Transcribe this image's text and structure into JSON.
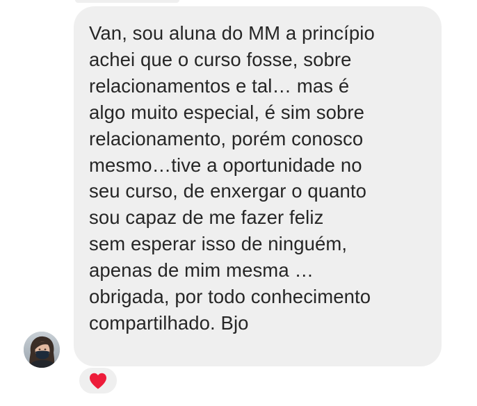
{
  "message": {
    "text": "Van, sou aluna do MM a princípio\nachei que o curso fosse, sobre\nrelacionamentos e tal… mas é\nalgo muito especial, é sim sobre\nrelacionamento, porém conosco\nmesmo…tive a oportunidade no\nseu curso, de enxergar o quanto\nsou capaz de me fazer feliz\nsem esperar isso de ninguém,\napenas de mim mesma …\nobrigada, por todo conhecimento\ncompartilhado. Bjo",
    "bubble_color": "#efefef",
    "text_color": "#262626"
  },
  "sender": {
    "avatar_icon": "profile-photo"
  },
  "reaction": {
    "icon": "heart-icon",
    "color": "#ed1c3a"
  }
}
